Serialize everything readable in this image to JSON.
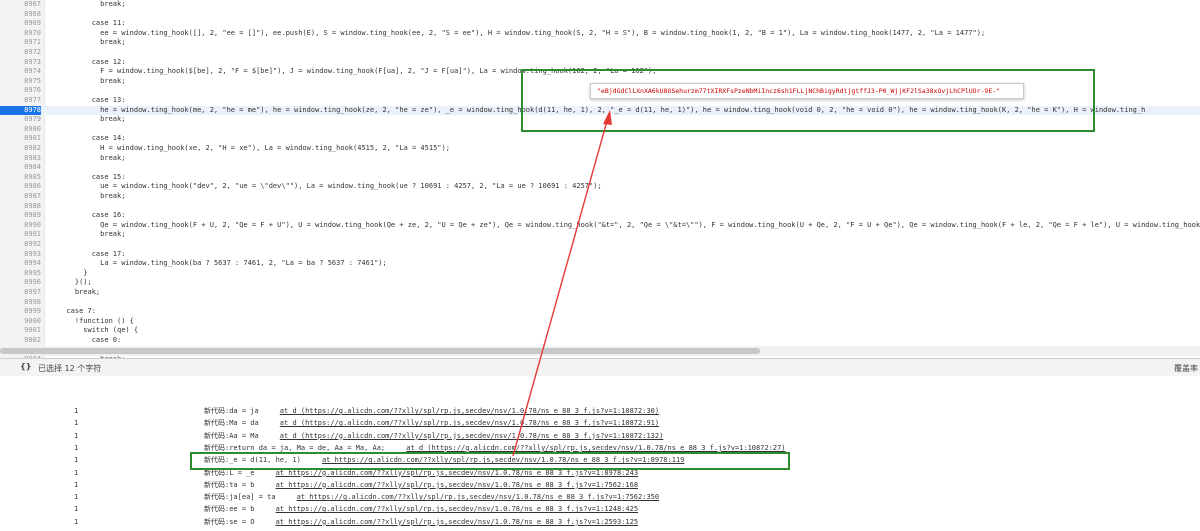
{
  "editor": {
    "lines": [
      {
        "no": "8967",
        "code": "          break;"
      },
      {
        "no": "8968",
        "code": ""
      },
      {
        "no": "8969",
        "code": "        case 11:"
      },
      {
        "no": "8970",
        "code": "          ee = window.ting_hook([], 2, \"ee = []\"), ee.push(E), S = window.ting_hook(ee, 2, \"S = ee\"), H = window.ting_hook(S, 2, \"H = S\"), B = window.ting_hook(1, 2, \"B = 1\"), La = window.ting_hook(1477, 2, \"La = 1477\");"
      },
      {
        "no": "8971",
        "code": "          break;"
      },
      {
        "no": "8972",
        "code": ""
      },
      {
        "no": "8973",
        "code": "        case 12:"
      },
      {
        "no": "8974",
        "code": "          F = window.ting_hook($[be], 2, \"F = $[be]\"), J = window.ting_hook(F[ua], 2, \"J = F[ua]\"), La = window.ting_hook(162, 2, \"La = 162\");"
      },
      {
        "no": "8975",
        "code": "          break;"
      },
      {
        "no": "8976",
        "code": ""
      },
      {
        "no": "8977",
        "code": "        case 13:"
      },
      {
        "no": "8978",
        "code": "          he = window.ting_hook(me, 2, \"he = me\"), he = window.ting_hook(ze, 2, \"he = ze\"), _e = window.ting_hook(d(11, he, 1), 2, \"_e = d(11, he, 1)\"), he = window.ting_hook(void 0, 2, \"he = void 0\"), he = window.ting_hook(K, 2, \"he = K\"), H = window.ting_h"
      },
      {
        "no": "8979",
        "code": "          break;"
      },
      {
        "no": "8980",
        "code": ""
      },
      {
        "no": "8981",
        "code": "        case 14:"
      },
      {
        "no": "8982",
        "code": "          H = window.ting_hook(xe, 2, \"H = xe\"), La = window.ting_hook(4515, 2, \"La = 4515\");"
      },
      {
        "no": "8983",
        "code": "          break;"
      },
      {
        "no": "8984",
        "code": ""
      },
      {
        "no": "8985",
        "code": "        case 15:"
      },
      {
        "no": "8986",
        "code": "          ue = window.ting_hook(\"dev\", 2, \"ue = \\\"dev\\\"\"), La = window.ting_hook(ue ? 10691 : 4257, 2, \"La = ue ? 10691 : 4257\");"
      },
      {
        "no": "8987",
        "code": "          break;"
      },
      {
        "no": "8988",
        "code": ""
      },
      {
        "no": "8989",
        "code": "        case 16:"
      },
      {
        "no": "8990",
        "code": "          Qe = window.ting_hook(F + U, 2, \"Qe = F + U\"), U = window.ting_hook(Qe + ze, 2, \"U = Qe + ze\"), Qe = window.ting_hook(\"&t=\", 2, \"Qe = \\\"&t=\\\"\"), F = window.ting_hook(U + Qe, 2, \"F = U + Qe\"), Qe = window.ting_hook(F + le, 2, \"Qe = F + le\"), U = window.ting_hook"
      },
      {
        "no": "8991",
        "code": "          break;"
      },
      {
        "no": "8992",
        "code": ""
      },
      {
        "no": "8993",
        "code": "        case 17:"
      },
      {
        "no": "8994",
        "code": "          La = window.ting_hook(ba ? 5637 : 7461, 2, \"La = ba ? 5637 : 7461\");"
      },
      {
        "no": "8995",
        "code": "      }"
      },
      {
        "no": "8996",
        "code": "    }();"
      },
      {
        "no": "8997",
        "code": "    break;"
      },
      {
        "no": "8998",
        "code": ""
      },
      {
        "no": "8999",
        "code": "  case 7:"
      },
      {
        "no": "9000",
        "code": "    !function () {"
      },
      {
        "no": "9001",
        "code": "      switch (qe) {"
      },
      {
        "no": "9002",
        "code": "        case 0:"
      },
      {
        "no": "9003",
        "code": "          na = window.ting_hook(\"ta\", 2, \"na = \\\"ta\\\"\"), na += \"rg\", La = window.ting_hook(na ? 1476 : 101, 2, \"La = na ? 1476 : 101\");"
      },
      {
        "no": "9004",
        "code": "          break;"
      },
      {
        "no": "9005",
        "code": ""
      }
    ],
    "highlight_line": "8978",
    "tooltip": "\"eBjdGdClLXnXA6kU8OSehurzm77tXIRXFsPzeNbMiIncz6sh1FLLjNChBigyRdtjgtffJ3-P0_WjjKF2lSa38xOvjLhCPlUOr-9E-\""
  },
  "statusbar": {
    "braces": "{}",
    "selection": "已选择 12 个字符",
    "right": "覆盖率"
  },
  "console": {
    "rows": [
      {
        "count": "1",
        "text": "新代码:da = ja",
        "link": "at d (https://g.alicdn.com/??xlly/spl/rp.js,secdev/nsv/1.0.78/ns_e_88_3_f.js?v=1:10872:30)"
      },
      {
        "count": "1",
        "text": "新代码:Ma = da",
        "link": "at d (https://g.alicdn.com/??xlly/spl/rp.js,secdev/nsv/1.0.78/ns_e_88_3_f.js?v=1:10872:91)"
      },
      {
        "count": "1",
        "text": "新代码:Aa = Ma",
        "link": "at d (https://g.alicdn.com/??xlly/spl/rp.js,secdev/nsv/1.0.78/ns_e_88_3_f.js?v=1:10872:132)"
      },
      {
        "count": "1",
        "text": "新代码:return da = ja, Ma = de, Aa = Ma, Aa;",
        "link": "at d (https://g.alicdn.com/??xlly/spl/rp.js,secdev/nsv/1.0.78/ns_e_88_3_f.js?v=1:10872:27)"
      },
      {
        "count": "1",
        "text": "新代码:_e = d(11, he, 1)",
        "link": "at https://g.alicdn.com/??xlly/spl/rp.js,secdev/nsv/1.0.78/ns_e_88_3_f.js?v=1:8978:119"
      },
      {
        "count": "1",
        "text": "新代码:L = _e",
        "link": "at https://g.alicdn.com/??xlly/spl/rp.js,secdev/nsv/1.0.78/ns_e_88_3_f.js?v=1:8978:243"
      },
      {
        "count": "1",
        "text": "新代码:ta = b",
        "link": "at https://g.alicdn.com/??xlly/spl/rp.js,secdev/nsv/1.0.78/ns_e_88_3_f.js?v=1:7562:168"
      },
      {
        "count": "1",
        "text": "新代码:ja[ea] = ta",
        "link": "at https://g.alicdn.com/??xlly/spl/rp.js,secdev/nsv/1.0.78/ns_e_88_3_f.js?v=1:7562:350"
      },
      {
        "count": "1",
        "text": "新代码:ee = b",
        "link": "at https://g.alicdn.com/??xlly/spl/rp.js,secdev/nsv/1.0.78/ns_e_88_3_f.js?v=1:1248:425"
      },
      {
        "count": "1",
        "text": "新代码:se = O",
        "link": "at https://g.alicdn.com/??xlly/spl/rp.js,secdev/nsv/1.0.78/ns_e_88_3_f.js?v=1:2593:125"
      }
    ]
  },
  "colors": {
    "accent": "#1a73e8",
    "annotation_box": "#2e8b2e",
    "arrow": "#e53935",
    "tooltip_text": "#c80000"
  }
}
